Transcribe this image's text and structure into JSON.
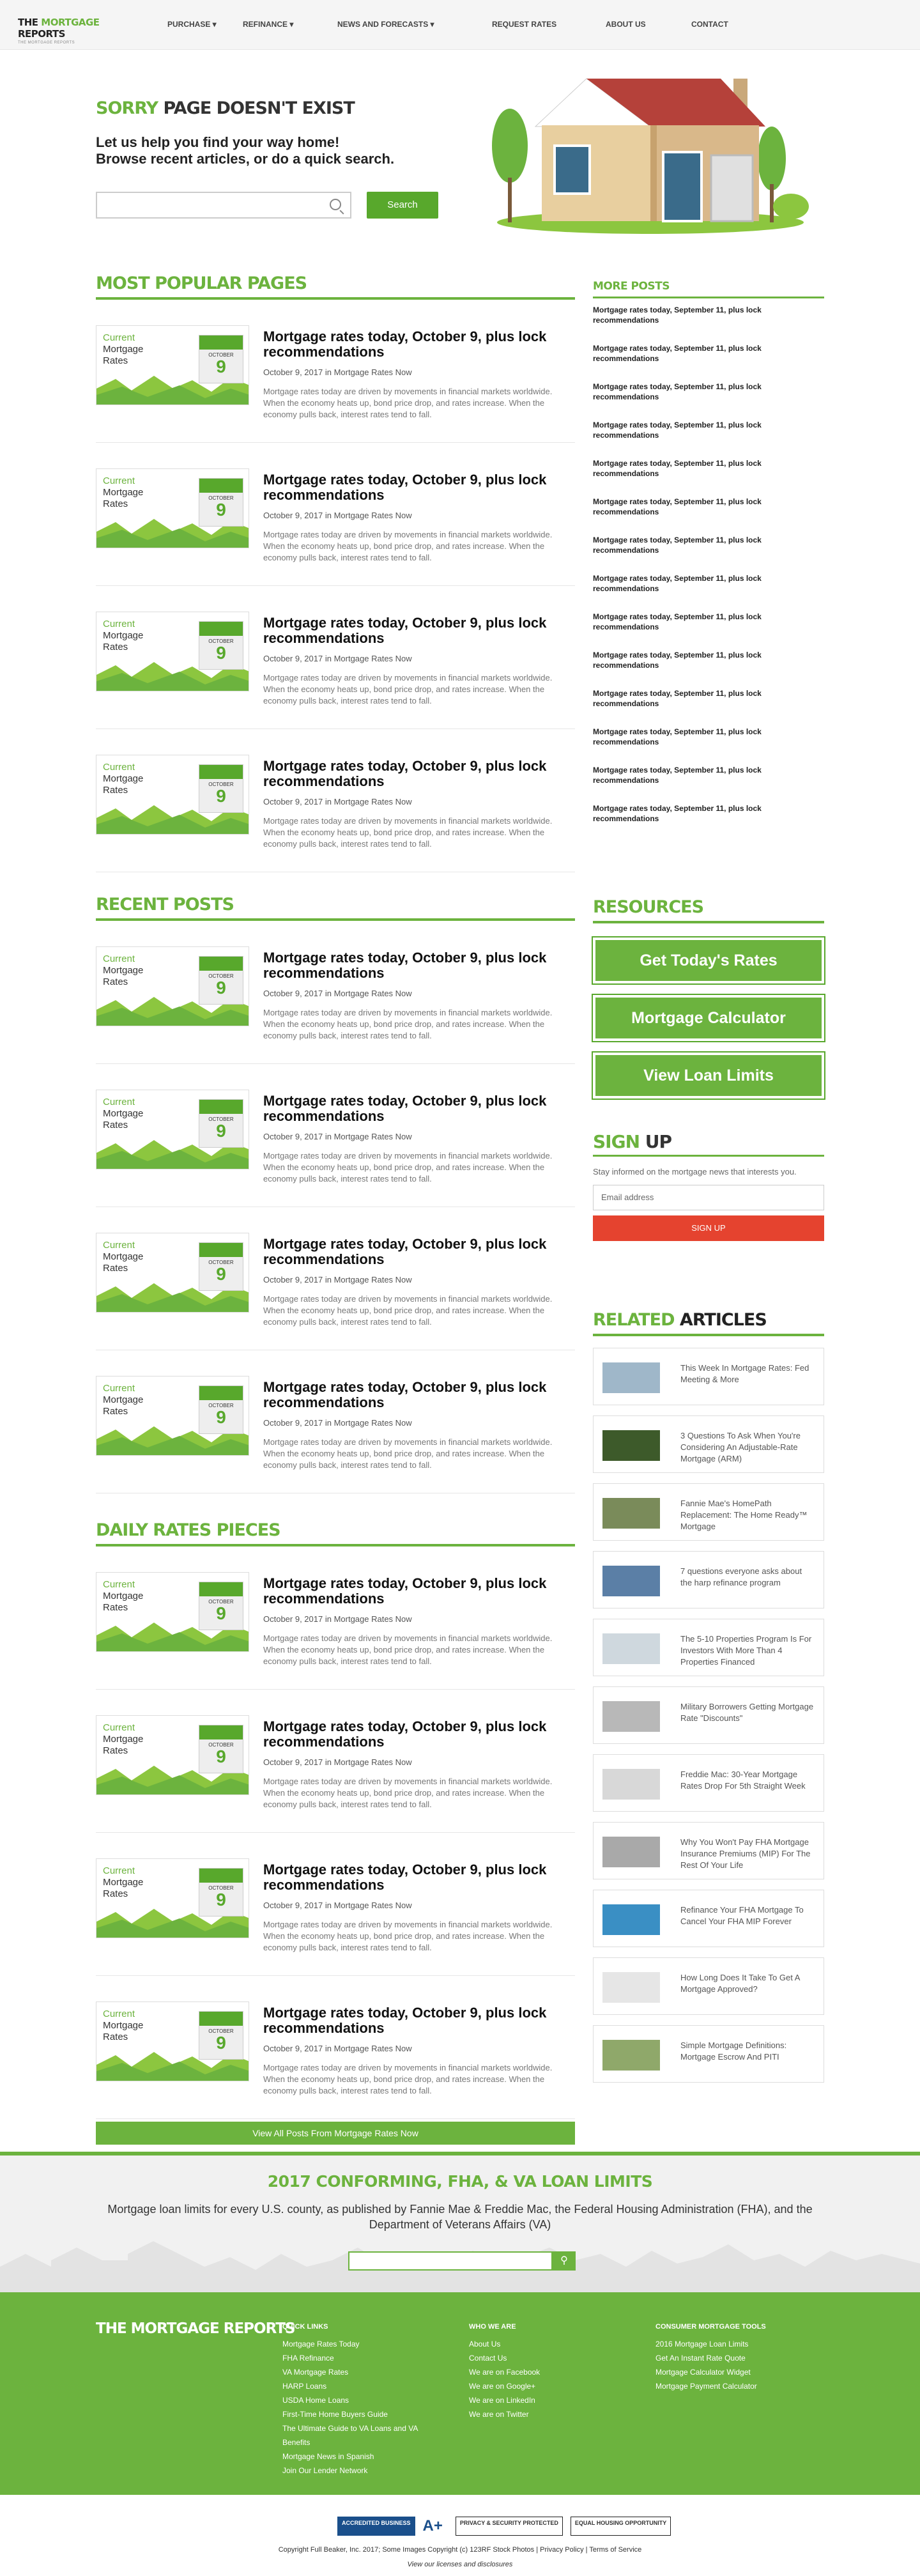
{
  "header": {
    "logo_the": "THE",
    "logo_mortgage": "MORTGAGE",
    "logo_reports": "REPORTS",
    "tagline": "THE MORTGAGE REPORTS",
    "nav": [
      "PURCHASE ▾",
      "REFINANCE ▾",
      "NEWS AND FORECASTS ▾",
      "REQUEST RATES",
      "ABOUT US",
      "CONTACT"
    ]
  },
  "hero": {
    "title_a": "SORRY",
    "title_b": "PAGE DOESN'T EXIST",
    "sub1": "Let us help you find your way home!",
    "sub2": "Browse recent articles, or do a quick search.",
    "search_value": "",
    "search_button": "Search"
  },
  "thumb": {
    "line1": "Current",
    "line2": "Mortgage",
    "line3": "Rates",
    "month": "OCTOBER",
    "day": "9"
  },
  "post": {
    "title": "Mortgage rates today, October 9, plus lock recommendations",
    "meta": "October 9, 2017 in Mortgage Rates Now",
    "excerpt": "Mortgage rates today are driven by movements in financial markets worldwide. When the economy heats up, bond price drop, and rates increase. When the economy pulls back, interest rates tend to fall."
  },
  "sections": {
    "popular": "MOST POPULAR PAGES",
    "recent": "RECENT POSTS",
    "daily": "DAILY RATES PIECES"
  },
  "more_posts": {
    "title": "MORE POSTS",
    "item": "Mortgage rates today, September 11, plus lock recommendations"
  },
  "resources": {
    "title": "RESOURCES",
    "buttons": [
      "Get Today's Rates",
      "Mortgage Calculator",
      "View Loan Limits"
    ]
  },
  "signup": {
    "title_a": "SIGN",
    "title_b": "UP",
    "text": "Stay informed on the mortgage news that interests you.",
    "email_placeholder": "Email address",
    "button": "SIGN UP"
  },
  "related": {
    "title_a": "RELATED",
    "title_b": "ARTICLES",
    "items": [
      "This Week In Mortgage Rates: Fed Meeting & More",
      "3 Questions To Ask When You're Considering An Adjustable-Rate Mortgage (ARM)",
      "Fannie Mae's HomePath Replacement: The Home Ready™ Mortgage",
      "7 questions everyone asks about the harp refinance program",
      "The 5-10 Properties Program Is For Investors With More Than 4 Properties Financed",
      "Military Borrowers Getting Mortgage Rate \"Discounts\"",
      "Freddie Mac: 30-Year Mortgage Rates Drop For 5th Straight Week",
      "Why You Won't Pay FHA Mortgage Insurance Premiums (MIP) For The Rest Of Your Life",
      "Refinance Your FHA Mortgage To Cancel Your FHA MIP Forever",
      "How Long Does It Take To Get A Mortgage Approved?",
      "Simple Mortgage Definitions: Mortgage Escrow And PITI"
    ]
  },
  "view_all": "View All Posts From Mortgage Rates Now",
  "limits": {
    "title": "2017 CONFORMING, FHA, & VA LOAN LIMITS",
    "text": "Mortgage loan limits for every U.S. county, as published by Fannie Mae & Freddie Mac, the Federal Housing Administration (FHA), and the Department of Veterans Affairs (VA)",
    "button_icon": "search-icon"
  },
  "footer": {
    "logo": "THE MORTGAGE REPORTS",
    "quick_title": "QUICK LINKS",
    "quick": [
      "Mortgage Rates Today",
      "FHA Refinance",
      "VA Mortgage Rates",
      "HARP Loans",
      "USDA Home Loans",
      "First-Time Home Buyers Guide",
      "The Ultimate Guide to VA Loans and VA Benefits",
      "Mortgage News in Spanish",
      "Join Our Lender Network"
    ],
    "who_title": "WHO WE ARE",
    "who": [
      "About Us",
      "Contact Us",
      "We are on Facebook",
      "We are on Google+",
      "We are on LinkedIn",
      "We are on Twitter"
    ],
    "tools_title": "CONSUMER MORTGAGE TOOLS",
    "tools": [
      "2016 Mortgage Loan Limits",
      "Get An Instant Rate Quote",
      "Mortgage Calculator Widget",
      "Mortgage Payment Calculator"
    ]
  },
  "bottom": {
    "badges": [
      "ACCREDITED BUSINESS",
      "A+",
      "PRIVACY & SECURITY PROTECTED",
      "EQUAL HOUSING OPPORTUNITY"
    ],
    "copyright": "Copyright Full Beaker, Inc. 2017; Some Images Copyright (c) 123RF Stock Photos | Privacy Policy | Terms of Service",
    "licenses": "View our licenses and disclosures"
  },
  "colors": {
    "brand_green": "#6cb33e",
    "signup_red": "#e5432f"
  }
}
